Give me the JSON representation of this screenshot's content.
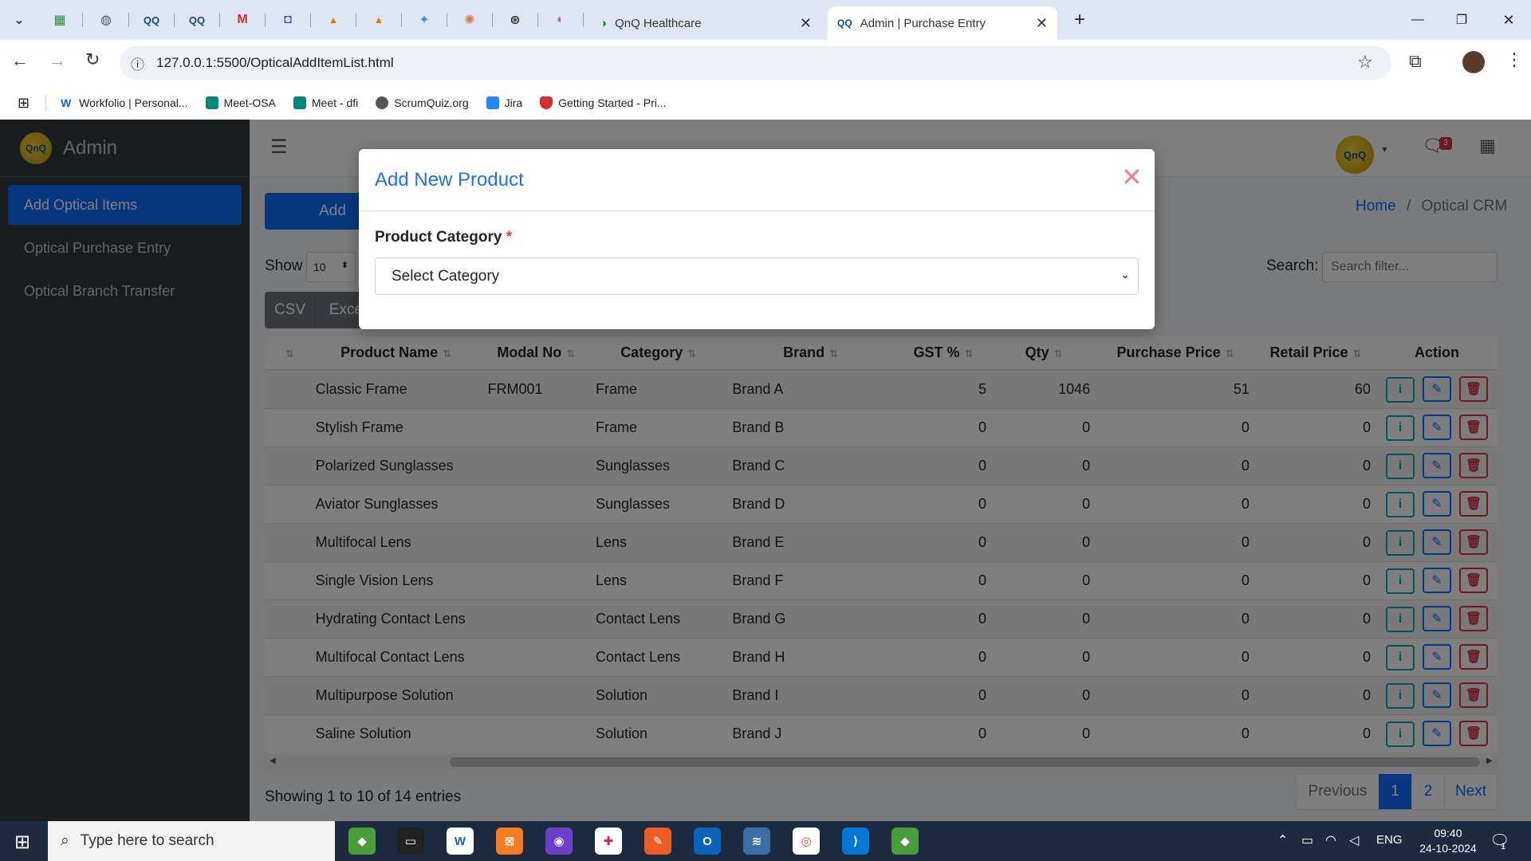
{
  "browser": {
    "tabs": [
      {
        "title": "QnQ Healthcare",
        "active": false
      },
      {
        "title": "Admin | Purchase Entry",
        "active": true
      }
    ],
    "url": "127.0.0.1:5500/OpticalAddItemList.html",
    "bookmarks": [
      "Workfolio | Personal...",
      "Meet-OSA",
      "Meet - dfi",
      "ScrumQuiz.org",
      "Jira",
      "Getting Started - Pri..."
    ]
  },
  "app": {
    "brand": "Admin",
    "logo_text": "QnQ",
    "notification_count": "3",
    "sidebar": {
      "items": [
        {
          "label": "Add Optical Items",
          "active": true
        },
        {
          "label": "Optical Purchase Entry",
          "active": false
        },
        {
          "label": "Optical Branch Transfer",
          "active": false
        }
      ]
    },
    "breadcrumb": {
      "home": "Home",
      "separator": "/",
      "current": "Optical CRM"
    },
    "add_button": "Add",
    "show_label": "Show",
    "page_size": "10",
    "search_label": "Search:",
    "search_placeholder": "Search filter...",
    "export_buttons": [
      "CSV",
      "Excel"
    ]
  },
  "table": {
    "columns": [
      "Product Name",
      "Modal No",
      "Category",
      "Brand",
      "GST %",
      "Qty",
      "Purchase Price",
      "Retail Price",
      "Action"
    ],
    "rows": [
      [
        "Classic Frame",
        "FRM001",
        "Frame",
        "Brand A",
        "5",
        "1046",
        "51",
        "60"
      ],
      [
        "Stylish Frame",
        "",
        "Frame",
        "Brand B",
        "0",
        "0",
        "0",
        "0"
      ],
      [
        "Polarized Sunglasses",
        "",
        "Sunglasses",
        "Brand C",
        "0",
        "0",
        "0",
        "0"
      ],
      [
        "Aviator Sunglasses",
        "",
        "Sunglasses",
        "Brand D",
        "0",
        "0",
        "0",
        "0"
      ],
      [
        "Multifocal Lens",
        "",
        "Lens",
        "Brand E",
        "0",
        "0",
        "0",
        "0"
      ],
      [
        "Single Vision Lens",
        "",
        "Lens",
        "Brand F",
        "0",
        "0",
        "0",
        "0"
      ],
      [
        "Hydrating Contact Lens",
        "",
        "Contact Lens",
        "Brand G",
        "0",
        "0",
        "0",
        "0"
      ],
      [
        "Multifocal Contact Lens",
        "",
        "Contact Lens",
        "Brand H",
        "0",
        "0",
        "0",
        "0"
      ],
      [
        "Multipurpose Solution",
        "",
        "Solution",
        "Brand I",
        "0",
        "0",
        "0",
        "0"
      ],
      [
        "Saline Solution",
        "",
        "Solution",
        "Brand J",
        "0",
        "0",
        "0",
        "0"
      ]
    ],
    "info": "Showing 1 to 10 of 14 entries",
    "pagination": {
      "previous": "Previous",
      "pages": [
        "1",
        "2"
      ],
      "current": "1",
      "next": "Next"
    }
  },
  "modal": {
    "title": "Add New Product",
    "field_label": "Product Category",
    "required_mark": "*",
    "select_value": "Select Category"
  },
  "taskbar": {
    "search_placeholder": "Type here to search",
    "language": "ENG",
    "time": "09:40",
    "date": "24-10-2024",
    "notification_count": "1"
  },
  "colors": {
    "primary": "#0d6efd",
    "sidebar": "#343a40",
    "danger": "#dc3545",
    "info": "#17a2b8",
    "modal_title": "#1a73e8"
  }
}
